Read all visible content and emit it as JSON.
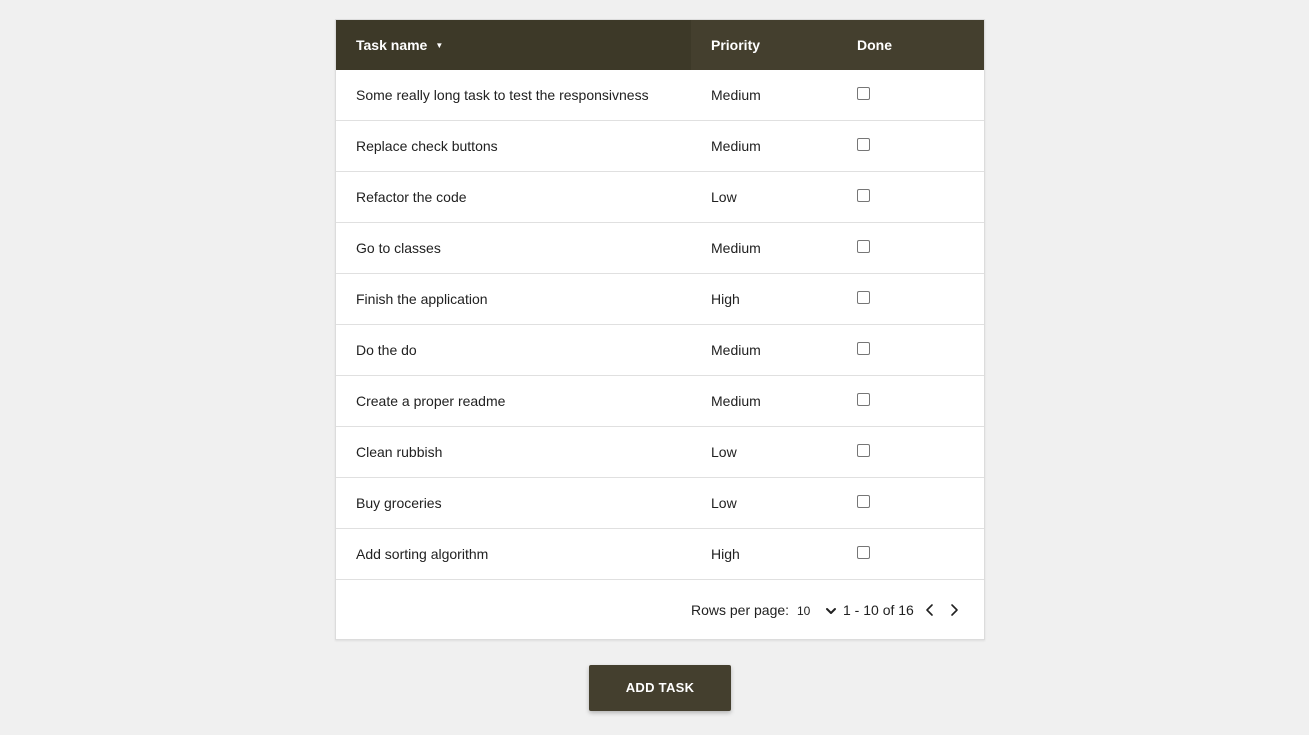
{
  "table": {
    "columns": {
      "name": "Task name",
      "priority": "Priority",
      "done": "Done"
    },
    "sort_indicator": "▼",
    "rows": [
      {
        "name": "Some really long task to test the responsivness",
        "priority": "Medium",
        "done": false
      },
      {
        "name": "Replace check buttons",
        "priority": "Medium",
        "done": false
      },
      {
        "name": "Refactor the code",
        "priority": "Low",
        "done": false
      },
      {
        "name": "Go to classes",
        "priority": "Medium",
        "done": false
      },
      {
        "name": "Finish the application",
        "priority": "High",
        "done": false
      },
      {
        "name": "Do the do",
        "priority": "Medium",
        "done": false
      },
      {
        "name": "Create a proper readme",
        "priority": "Medium",
        "done": false
      },
      {
        "name": "Clean rubbish",
        "priority": "Low",
        "done": false
      },
      {
        "name": "Buy groceries",
        "priority": "Low",
        "done": false
      },
      {
        "name": "Add sorting algorithm",
        "priority": "High",
        "done": false
      }
    ]
  },
  "pagination": {
    "rows_per_page_label": "Rows per page:",
    "rows_per_page_value": "10",
    "range_text": "1 - 10 of 16",
    "prev_icon": "chevron-left-icon",
    "next_icon": "chevron-right-icon"
  },
  "actions": {
    "add_task_label": "ADD TASK"
  },
  "colors": {
    "header_bg": "#443f2e",
    "sorted_header_bg": "#3d3928",
    "button_bg": "#443f2e",
    "page_bg": "#f0f0f0"
  }
}
